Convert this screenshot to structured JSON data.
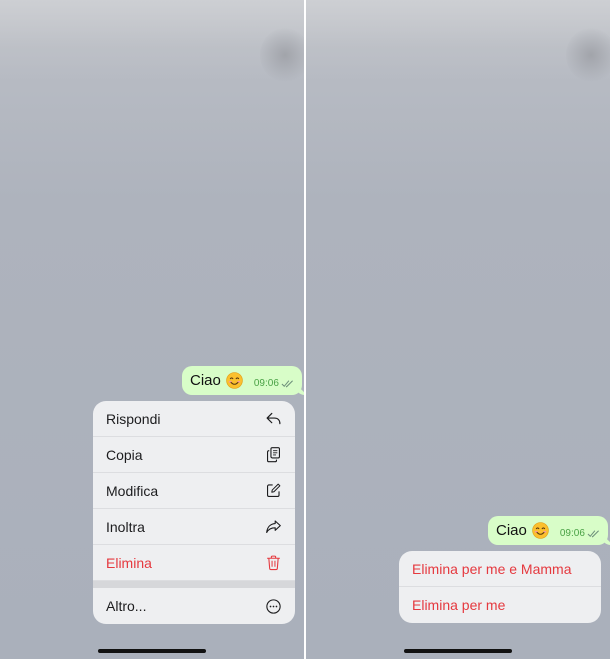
{
  "screens": [
    {
      "message": {
        "text": "Ciao",
        "emoji": "smiling-face-emoji",
        "time": "09:06",
        "status": "double-check-icon"
      },
      "menu": {
        "items": [
          {
            "label": "Rispondi",
            "icon": "reply-icon",
            "destructive": false
          },
          {
            "label": "Copia",
            "icon": "copy-icon",
            "destructive": false
          },
          {
            "label": "Modifica",
            "icon": "edit-icon",
            "destructive": false
          },
          {
            "label": "Inoltra",
            "icon": "forward-icon",
            "destructive": false
          },
          {
            "label": "Elimina",
            "icon": "trash-icon",
            "destructive": true
          }
        ],
        "more": {
          "label": "Altro...",
          "icon": "more-icon"
        }
      }
    },
    {
      "message": {
        "text": "Ciao",
        "emoji": "smiling-face-emoji",
        "time": "09:06",
        "status": "double-check-icon"
      },
      "delete_options": [
        {
          "label": "Elimina per me e Mamma"
        },
        {
          "label": "Elimina per me"
        }
      ]
    }
  ],
  "colors": {
    "bubble": "#d8fdc8",
    "time_text": "#4aa246",
    "destructive": "#e5393f",
    "menu_bg": "#eeeff1",
    "divider": "#ffffff"
  }
}
